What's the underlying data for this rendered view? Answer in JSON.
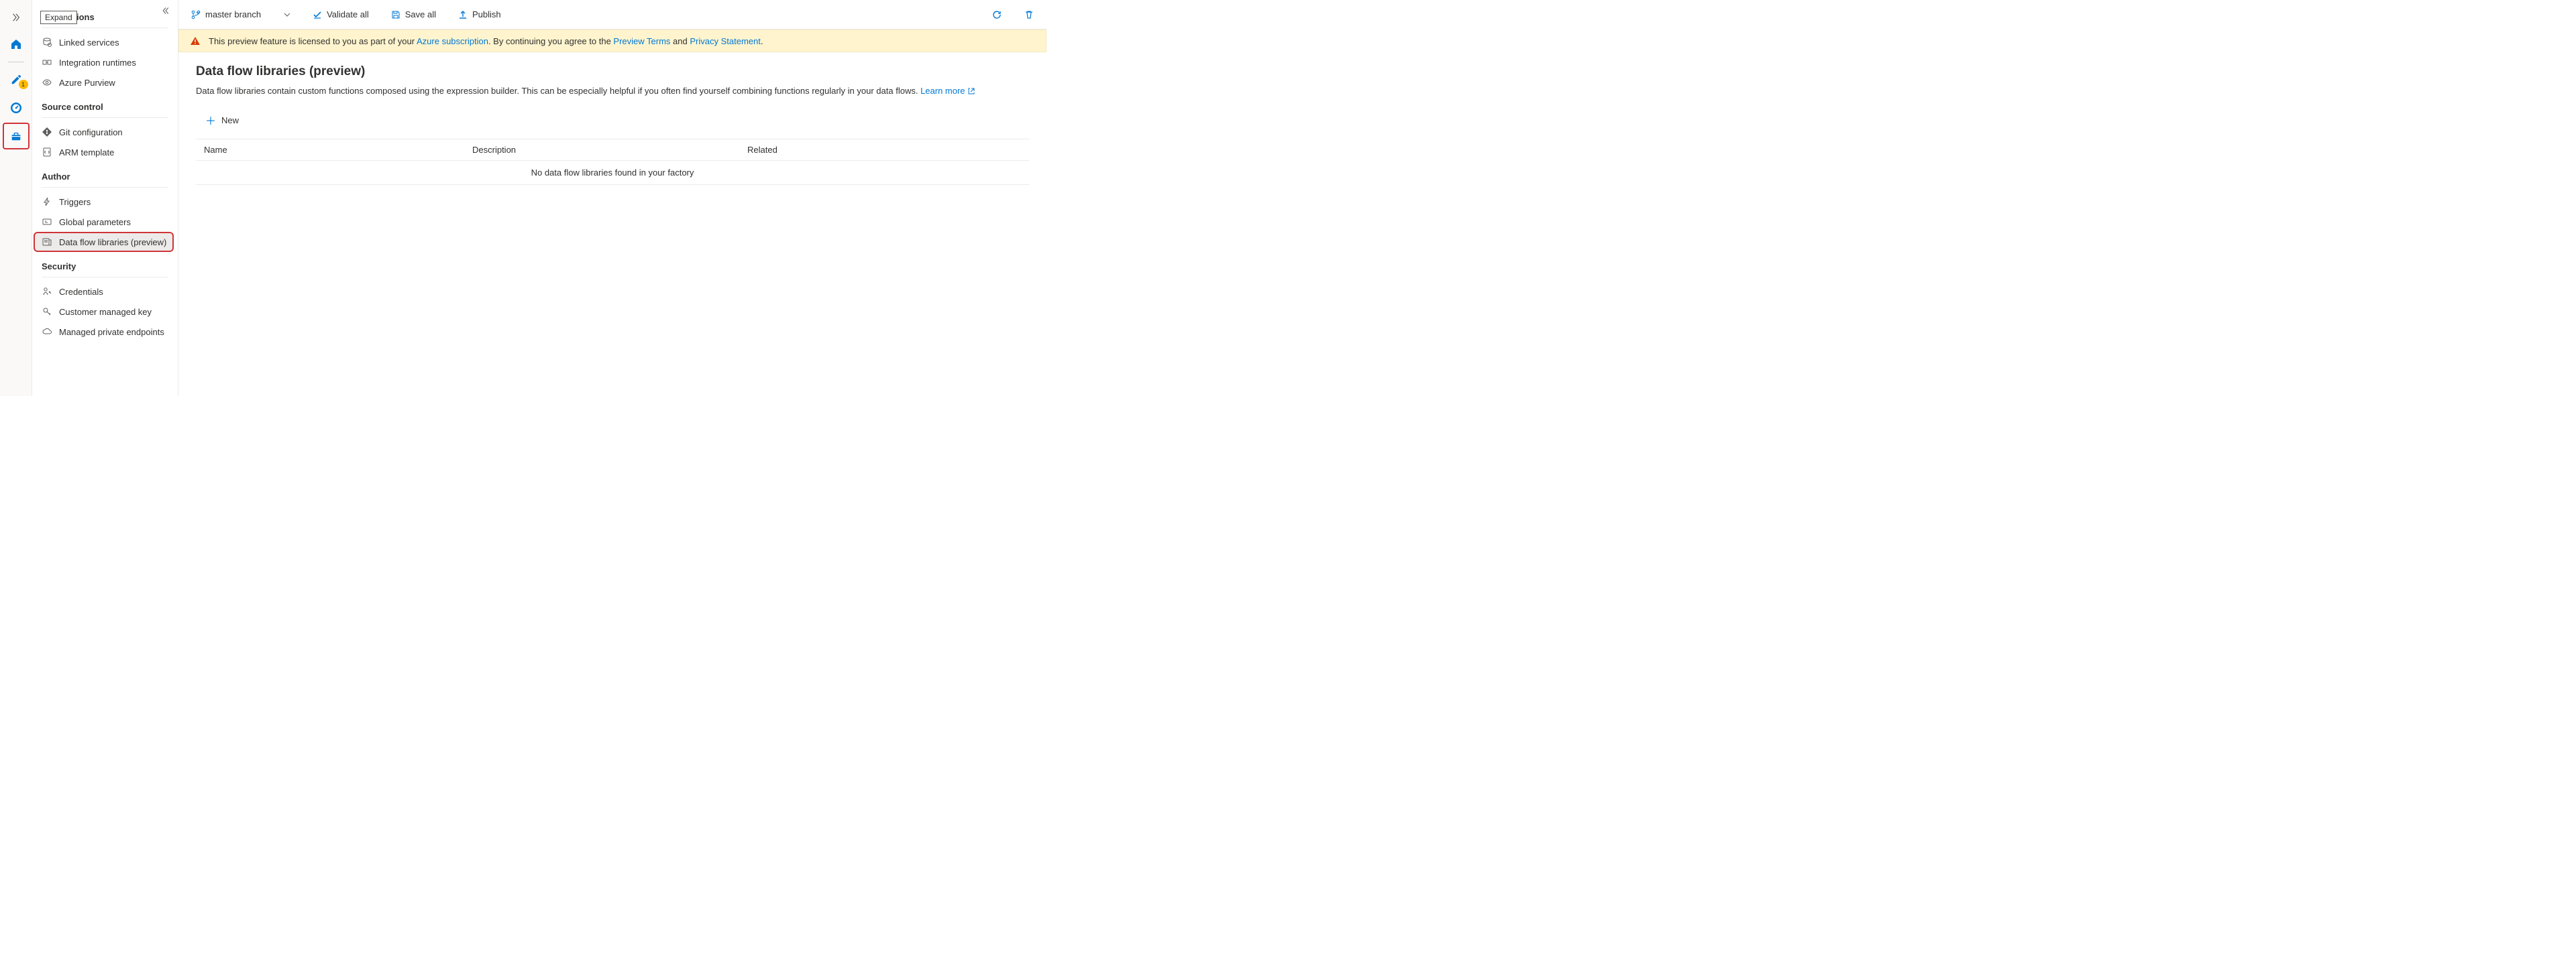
{
  "rail": {
    "expand_tooltip": "Expand",
    "pencil_badge": "1"
  },
  "toolbar": {
    "branch_label": "master branch",
    "validate_label": "Validate all",
    "save_label": "Save all",
    "publish_label": "Publish"
  },
  "banner": {
    "prefix": "This preview feature is licensed to you as part of your ",
    "link1": "Azure subscription",
    "mid1": ". By continuing you agree to the ",
    "link2": "Preview Terms",
    "mid2": " and ",
    "link3": "Privacy Statement",
    "suffix": "."
  },
  "sidebar": {
    "groups": [
      {
        "title": "Connections",
        "items": [
          {
            "label": "Linked services"
          },
          {
            "label": "Integration runtimes"
          },
          {
            "label": "Azure Purview"
          }
        ]
      },
      {
        "title": "Source control",
        "items": [
          {
            "label": "Git configuration"
          },
          {
            "label": "ARM template"
          }
        ]
      },
      {
        "title": "Author",
        "items": [
          {
            "label": "Triggers"
          },
          {
            "label": "Global parameters"
          },
          {
            "label": "Data flow libraries (preview)",
            "selected": true
          }
        ]
      },
      {
        "title": "Security",
        "items": [
          {
            "label": "Credentials"
          },
          {
            "label": "Customer managed key"
          },
          {
            "label": "Managed private endpoints"
          }
        ]
      }
    ]
  },
  "page": {
    "title": "Data flow libraries (preview)",
    "description": "Data flow libraries contain custom functions composed using the expression builder. This can be especially helpful if you often find yourself combining functions regularly in your data flows. ",
    "learn_more": "Learn more",
    "new_label": "New",
    "columns": {
      "name": "Name",
      "description": "Description",
      "related": "Related"
    },
    "empty": "No data flow libraries found in your factory"
  }
}
